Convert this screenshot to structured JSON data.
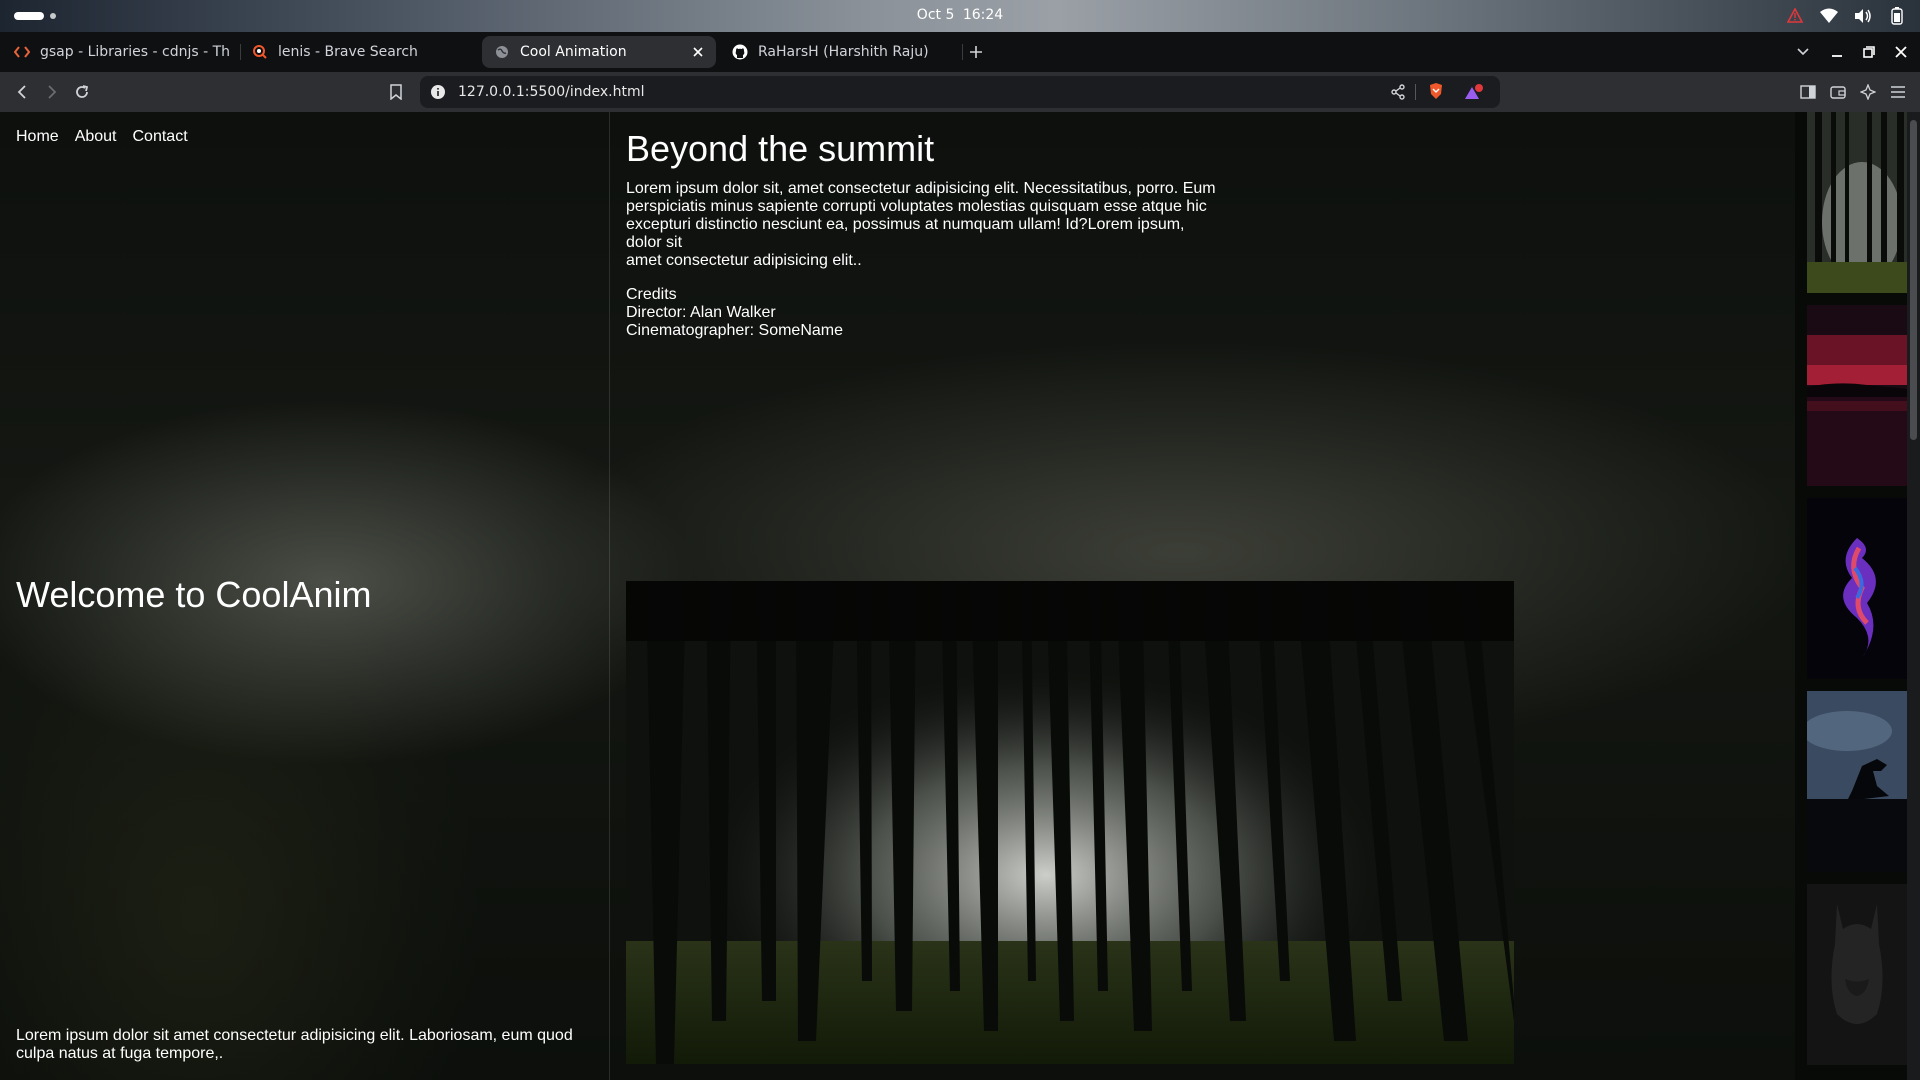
{
  "os": {
    "date": "Oct 5",
    "time": "16:24"
  },
  "tabs": [
    {
      "title": "gsap - Libraries - cdnjs - The #",
      "icon": "code-icon",
      "active": false
    },
    {
      "title": "lenis - Brave Search",
      "icon": "brave-search-icon",
      "active": false
    },
    {
      "title": "Cool Animation",
      "icon": "globe-icon",
      "active": true
    },
    {
      "title": "RaHarsH (Harshith Raju)",
      "icon": "github-icon",
      "active": false
    }
  ],
  "toolbar": {
    "url": "127.0.0.1:5500/index.html"
  },
  "page": {
    "nav": [
      "Home",
      "About",
      "Contact"
    ],
    "welcome": "Welcome to CoolAnim",
    "left_footer": "Lorem ipsum dolor sit amet consectetur adipisicing elit. Laboriosam, eum quod culpa natus at fuga tempore,.",
    "heading": "Beyond the summit",
    "body_lines": [
      "Lorem ipsum dolor sit, amet consectetur adipisicing elit. Necessitatibus, porro. Eum",
      "perspiciatis minus sapiente corrupti voluptates molestias quisquam esse atque hic",
      "excepturi distinctio nesciunt ea, possimus at numquam ullam! Id?Lorem ipsum,",
      "dolor sit",
      "amet consectetur adipisicing elit.."
    ],
    "credits": {
      "label": "Credits",
      "director": "Director: Alan Walker",
      "cinematographer": "Cinematographer: SomeName"
    },
    "thumbnails": [
      "forest",
      "red-sunset-lake",
      "colorful-smoke",
      "dinosaur-silhouette",
      "batman-dark"
    ]
  }
}
